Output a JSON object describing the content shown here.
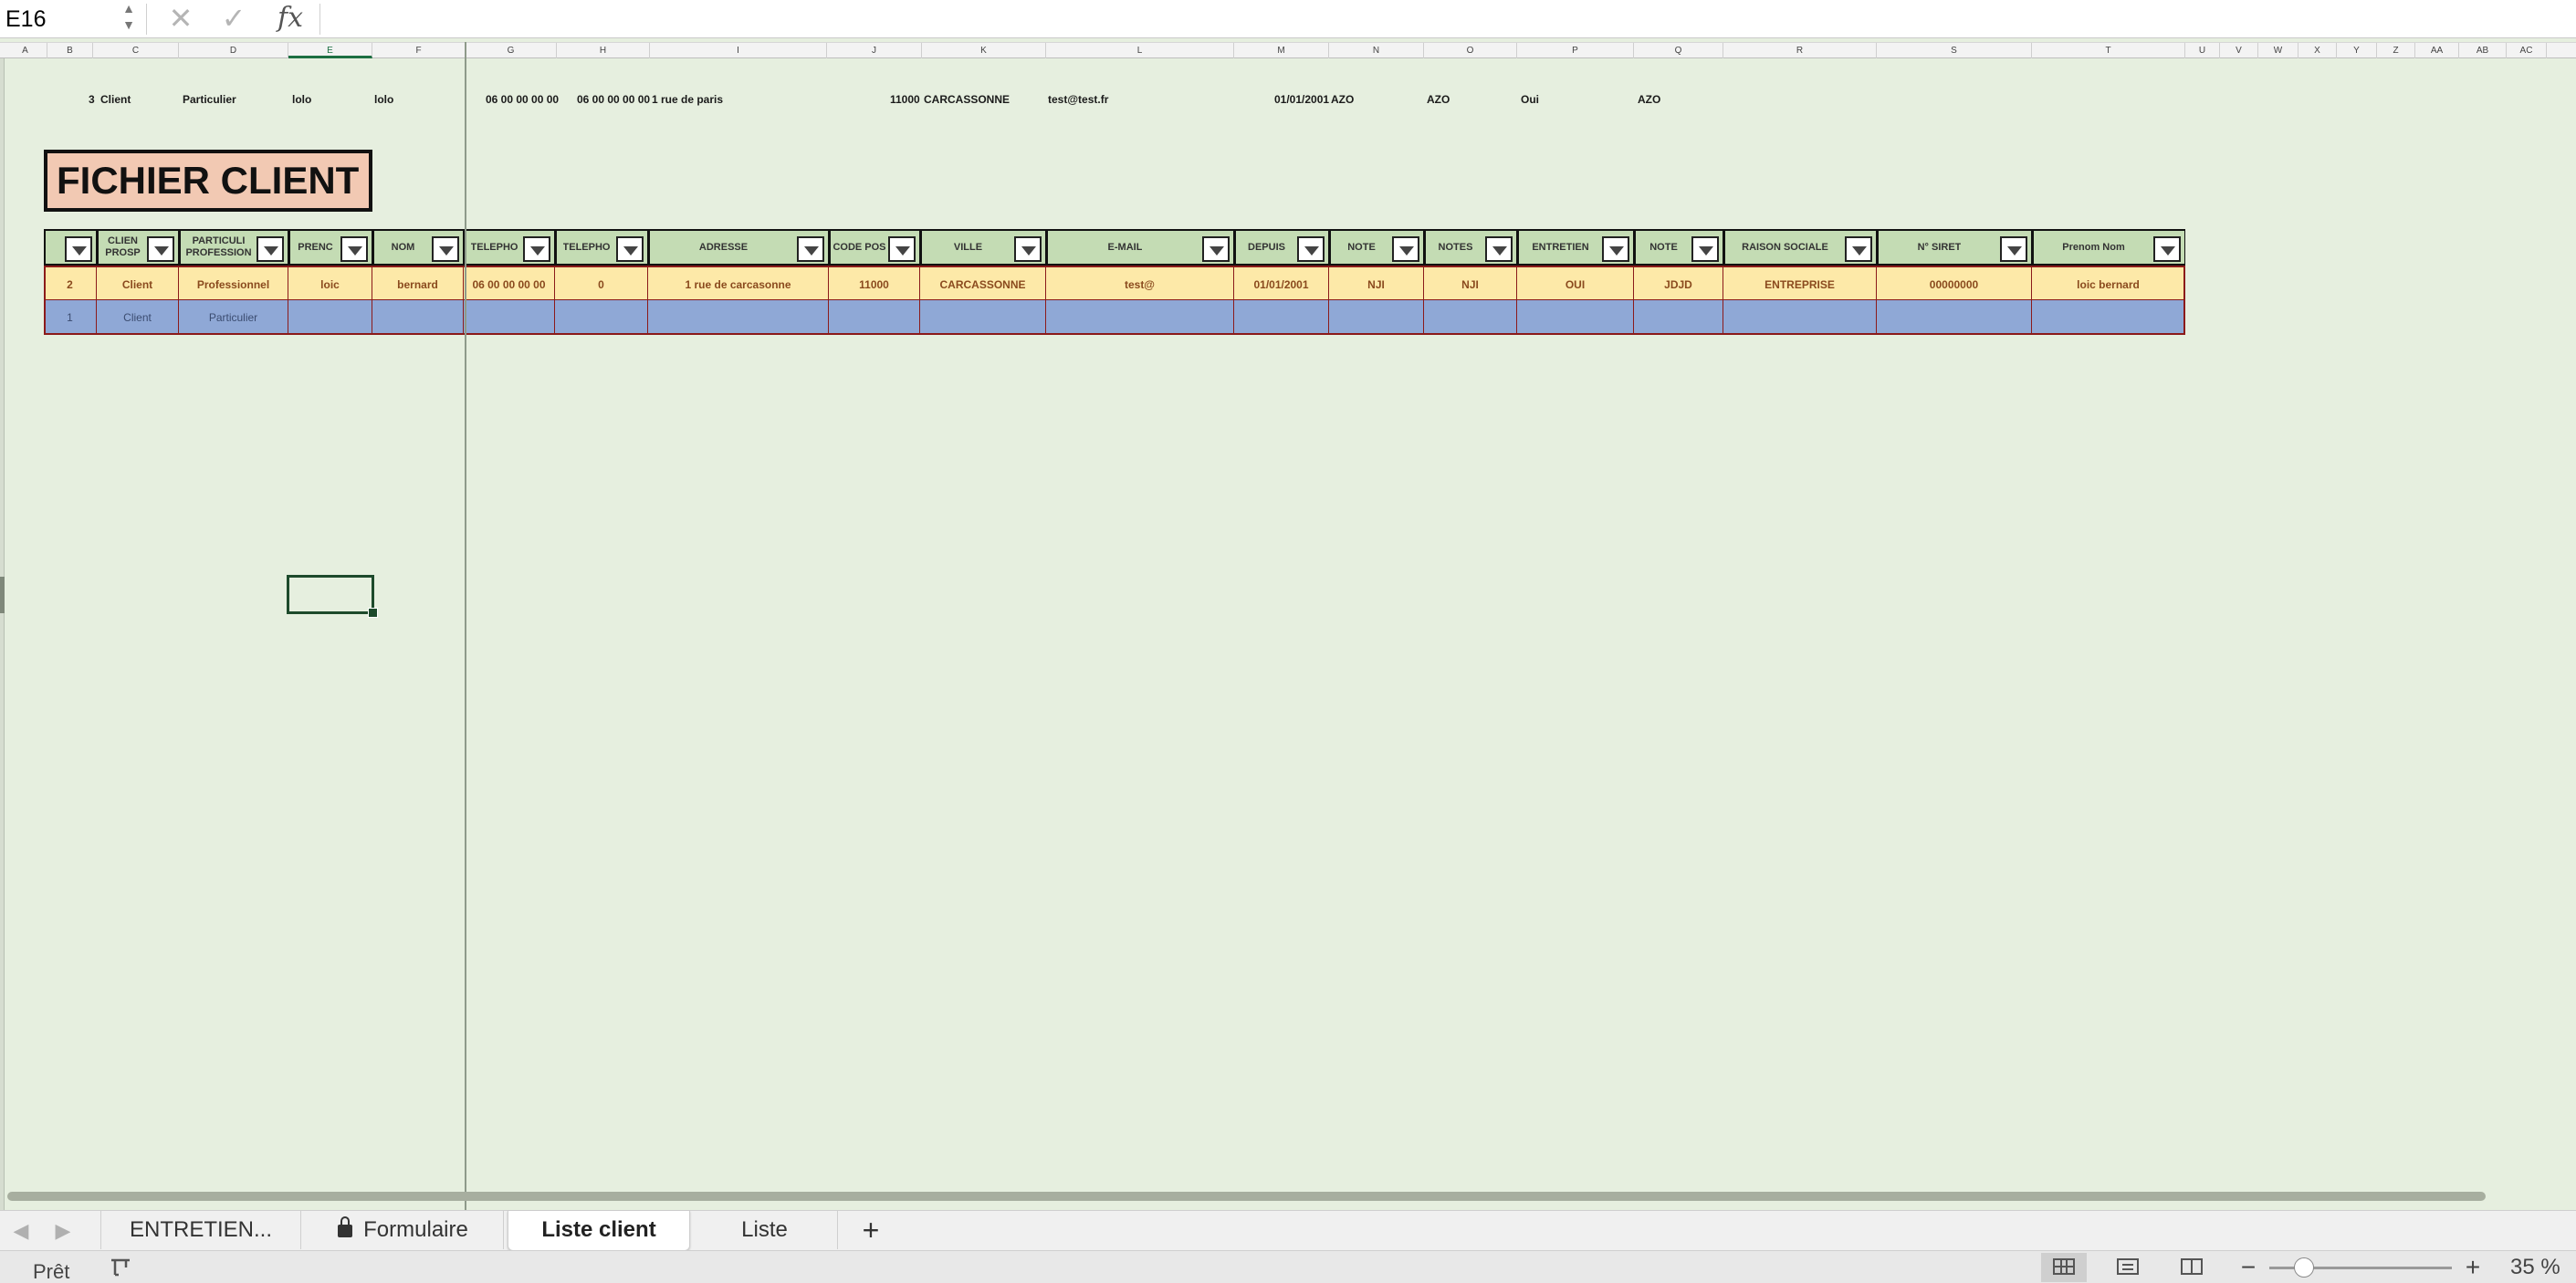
{
  "formula_bar": {
    "name_box": "E16",
    "cancel_icon": "✕",
    "enter_icon": "✓",
    "fx_label": "fx",
    "formula": ""
  },
  "columns": [
    "A",
    "B",
    "C",
    "D",
    "E",
    "F",
    "G",
    "H",
    "I",
    "J",
    "K",
    "L",
    "M",
    "N",
    "O",
    "P",
    "Q",
    "R",
    "S",
    "T",
    "U",
    "V",
    "W",
    "X",
    "Y",
    "Z",
    "AA",
    "AB",
    "AC"
  ],
  "top_row": {
    "b": "3",
    "c": "Client",
    "d": "Particulier",
    "e": "lolo",
    "f": "lolo",
    "g": "06 00 00 00 00",
    "h": "06 00 00 00 00",
    "i": "1 rue de paris",
    "j": "11000",
    "k": "CARCASSONNE",
    "l": "test@test.fr",
    "m": "01/01/2001",
    "n": "AZO",
    "o": "AZO",
    "p": "Oui",
    "q": "AZO"
  },
  "title": "FICHIER CLIENT",
  "table": {
    "headers": [
      "",
      "CLIENT PROSPECT",
      "PARTICULIER PROFESSIONNEL",
      "PRENOM",
      "NOM",
      "TELEPHONE",
      "TELEPHONE",
      "ADRESSE",
      "CODE POSTAL",
      "VILLE",
      "E-MAIL",
      "DEPUIS LE",
      "NOTES",
      "NOTES",
      "ENTRETIEN",
      "NOTES",
      "RAISON SOCIALE",
      "N° SIRET",
      "Prenom Nom"
    ],
    "header_display": [
      "",
      "CLIEN PROSP",
      "PARTICULI PROFESSION",
      "PRENC",
      "NOM",
      "TELEPHO",
      "TELEPHO",
      "ADRESSE",
      "CODE POS",
      "VILLE",
      "E-MAIL",
      "DEPUIS",
      "NOTE",
      "NOTES",
      "ENTRETIEN",
      "NOTE",
      "RAISON SOCIALE",
      "N° SIRET",
      "Prenom Nom"
    ],
    "rows": [
      [
        "2",
        "Client",
        "Professionnel",
        "loic",
        "bernard",
        "06 00 00 00 00",
        "0",
        "1 rue de carcasonne",
        "11000",
        "CARCASSONNE",
        "test@",
        "01/01/2001",
        "NJI",
        "NJI",
        "OUI",
        "JDJD",
        "ENTREPRISE",
        "00000000",
        "loic bernard"
      ],
      [
        "1",
        "Client",
        "Particulier",
        "",
        "",
        "",
        "",
        "",
        "",
        "",
        "",
        "",
        "",
        "",
        "",
        "",
        "",
        "",
        ""
      ]
    ]
  },
  "sheet_tabs": {
    "tab1": "ENTRETIEN...",
    "tab2": "Formulaire",
    "tab3": "Liste client",
    "tab4": "Liste",
    "add": "+"
  },
  "status_bar": {
    "status": "Prêt",
    "zoom_label": "35 %",
    "zoom_out": "−",
    "zoom_in": "+"
  },
  "colors": {
    "sheet_bg": "#e6efdf",
    "header_fill": "#c4dcb4",
    "row1_fill": "#fde9a8",
    "row2_fill": "#8fa8d6",
    "border_red": "#8b1a1a",
    "title_fill": "#f2c9b3"
  }
}
